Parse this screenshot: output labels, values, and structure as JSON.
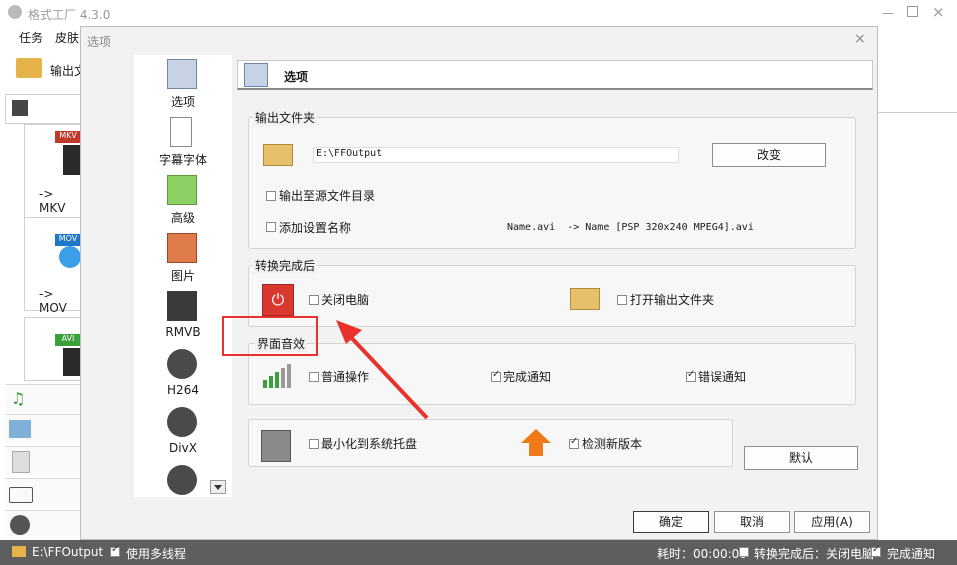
{
  "app": {
    "title": "格式工厂 4.3.0"
  },
  "menu": {
    "items": [
      "任务",
      "皮肤"
    ]
  },
  "toolbar": {
    "output_label": "输出文"
  },
  "formats": [
    {
      "badge": "MKV",
      "label": "-> MKV"
    },
    {
      "badge": "MOV",
      "label": "-> MOV"
    },
    {
      "badge": "AVI",
      "label": ""
    }
  ],
  "status": {
    "path": "E:\\FFOutput",
    "multithread": "使用多线程",
    "elapsed": "耗时：00:00:00",
    "after_convert": "转换完成后：关闭电脑",
    "done_notify": "完成通知"
  },
  "dialog": {
    "title": "选项",
    "close": "×",
    "header_title": "选项",
    "nav": [
      {
        "label": "选项",
        "icon": "gear-icon"
      },
      {
        "label": "字幕字体",
        "icon": "subtitle-font-icon"
      },
      {
        "label": "高级",
        "icon": "advanced-icon"
      },
      {
        "label": "图片",
        "icon": "picture-icon"
      },
      {
        "label": "RMVB",
        "icon": "rmvb-icon"
      },
      {
        "label": "H264",
        "icon": "h264-film-icon"
      },
      {
        "label": "DivX",
        "icon": "divx-film-icon"
      },
      {
        "label": "",
        "icon": "film-icon"
      }
    ],
    "output_folder": {
      "title": "输出文件夹",
      "path": "E:\\FFOutput",
      "change_button": "改变",
      "to_source": "输出至源文件目录",
      "add_setting_name": "添加设置名称",
      "example": "Name.avi  -> Name [PSP 320x240 MPEG4].avi"
    },
    "after_convert": {
      "title": "转换完成后",
      "shutdown": "关闭电脑",
      "open_folder": "打开输出文件夹"
    },
    "ui_sound": {
      "title": "界面音效",
      "normal_op": "普通操作",
      "done_notify": "完成通知",
      "error_notify": "错误通知"
    },
    "misc": {
      "minimize_tray": "最小化到系统托盘",
      "check_update": "检测新版本"
    },
    "buttons": {
      "default": "默认",
      "ok": "确定",
      "cancel": "取消",
      "apply": "应用(A)"
    }
  },
  "colors": {
    "annotation": "#e8322b",
    "statusbar": "#5e5e5e"
  }
}
